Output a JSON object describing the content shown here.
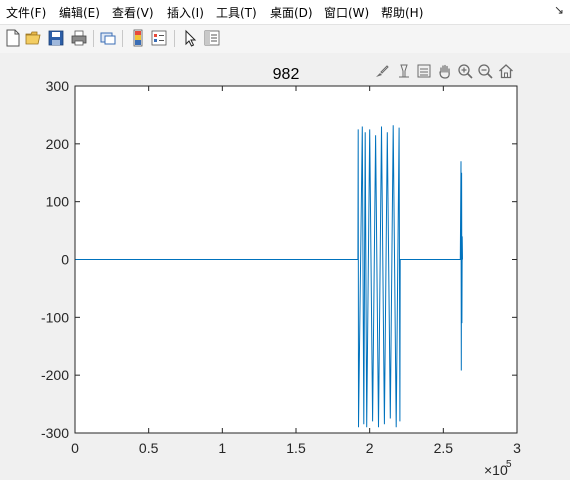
{
  "menubar": {
    "items": [
      {
        "label": "文件(F)"
      },
      {
        "label": "编辑(E)"
      },
      {
        "label": "查看(V)"
      },
      {
        "label": "插入(I)"
      },
      {
        "label": "工具(T)"
      },
      {
        "label": "桌面(D)"
      },
      {
        "label": "窗口(W)"
      },
      {
        "label": "帮助(H)"
      }
    ],
    "corner_icon": "dock-arrow-icon",
    "corner_glyph": "↘"
  },
  "toolbar": {
    "icons": [
      "new-figure-icon",
      "open-file-icon",
      "save-icon",
      "print-icon",
      "link-plot-icon",
      "colorbar-icon",
      "legend-icon",
      "select-arrow-icon",
      "property-inspector-icon"
    ]
  },
  "axes_toolbar": {
    "icons": [
      "brush-icon",
      "data-tip-icon",
      "pan-data-icon",
      "pan-hand-icon",
      "zoom-in-icon",
      "zoom-out-icon",
      "home-icon"
    ]
  },
  "colors": {
    "line": "#0072bd",
    "axes_bg": "#ffffff",
    "figure_bg": "#f0f0f0",
    "axis": "#262626"
  },
  "chart_data": {
    "type": "line",
    "title": "982",
    "xlabel": "",
    "ylabel": "",
    "xlim": [
      0,
      300000
    ],
    "ylim": [
      -300,
      300
    ],
    "x_exponent_label": "×10",
    "x_exponent_power": "5",
    "xticks": [
      0,
      50000,
      100000,
      150000,
      200000,
      250000,
      300000
    ],
    "xtick_labels": [
      "0",
      "0.5",
      "1",
      "1.5",
      "2",
      "2.5",
      "3"
    ],
    "yticks": [
      -300,
      -200,
      -100,
      0,
      100,
      200,
      300
    ],
    "ytick_labels": [
      "-300",
      "-200",
      "-100",
      "0",
      "100",
      "200",
      "300"
    ],
    "grid": false,
    "series": [
      {
        "x": [
          0,
          192000,
          192200,
          192400,
          195000,
          196000,
          197000,
          198000,
          200000,
          202000,
          204000,
          206000,
          208000,
          210000,
          212000,
          214000,
          216000,
          218000,
          220000,
          220500,
          220700,
          261500,
          262000,
          262200,
          262400,
          262600,
          262800,
          263000
        ],
        "y": [
          0,
          0,
          225,
          -290,
          230,
          -285,
          220,
          -290,
          225,
          -280,
          215,
          -290,
          230,
          -285,
          220,
          -275,
          232,
          -290,
          228,
          -280,
          0,
          0,
          170,
          -192,
          150,
          -110,
          40,
          0
        ]
      }
    ]
  }
}
